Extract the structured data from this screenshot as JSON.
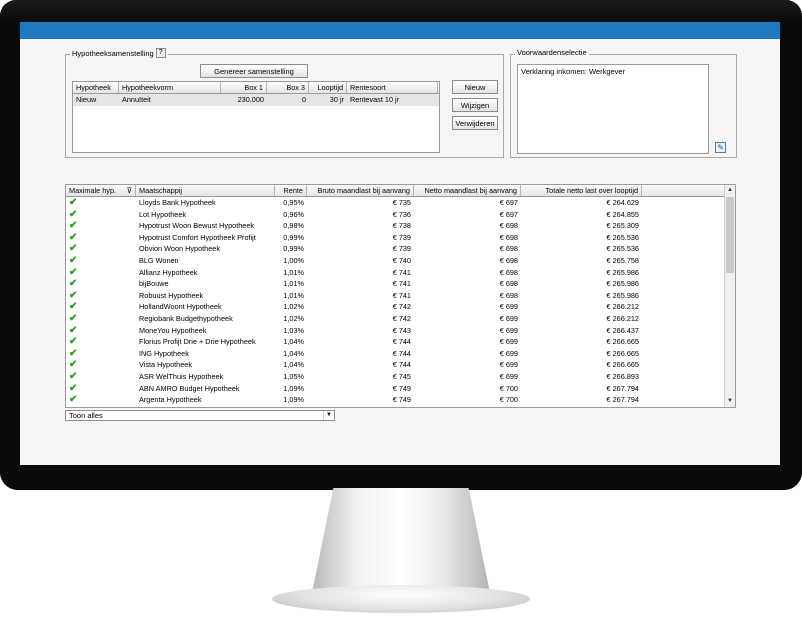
{
  "colors": {
    "titlebar": "#1d7ac3",
    "check": "#2c9f24"
  },
  "hypotheek": {
    "legend": "Hypotheeksamenstelling",
    "help_label": "?",
    "generate_button": "Genereer samenstelling",
    "columns": [
      "Hypotheek",
      "Hypotheekvorm",
      "Box 1",
      "Box 3",
      "Looptijd",
      "Rentesoort"
    ],
    "rows": [
      {
        "hypotheek": "Nieuw",
        "vorm": "Annuïteit",
        "box1": "230.000",
        "box3": "0",
        "looptijd": "30 jr",
        "rentesoort": "Rentevast 10 jr"
      }
    ],
    "buttons": {
      "nieuw": "Nieuw",
      "wijzigen": "Wijzigen",
      "verwijderen": "Verwijderen"
    }
  },
  "voorwaarden": {
    "legend": "Voorwaardenselectie",
    "text": "Verklaring inkomen: Werkgever",
    "edit_icon": "edit-icon"
  },
  "results": {
    "columns": [
      "Maximale hyp.",
      "Maatschappij",
      "Rente",
      "Bruto maandlast bij aanvang",
      "Netto maandlast bij aanvang",
      "Totale netto last over looptijd"
    ],
    "filter_icon": "filter-icon",
    "rows": [
      {
        "name": "Lloyds Bank Hypotheek",
        "rente": "0,95%",
        "bruto": "€ 735",
        "netto": "€ 697",
        "totaal": "€ 264.629"
      },
      {
        "name": "Lot Hypotheek",
        "rente": "0,96%",
        "bruto": "€ 736",
        "netto": "€ 697",
        "totaal": "€ 264.855"
      },
      {
        "name": "Hypotrust Woon Bewust Hypotheek",
        "rente": "0,98%",
        "bruto": "€ 738",
        "netto": "€ 698",
        "totaal": "€ 265.309"
      },
      {
        "name": "Hypotrust Comfort Hypotheek Profijt",
        "rente": "0,99%",
        "bruto": "€ 739",
        "netto": "€ 698",
        "totaal": "€ 265.536"
      },
      {
        "name": "Obvion Woon Hypotheek",
        "rente": "0,99%",
        "bruto": "€ 739",
        "netto": "€ 698",
        "totaal": "€ 265.536"
      },
      {
        "name": "BLG Wonen",
        "rente": "1,00%",
        "bruto": "€ 740",
        "netto": "€ 698",
        "totaal": "€ 265.758"
      },
      {
        "name": "Allianz Hypotheek",
        "rente": "1,01%",
        "bruto": "€ 741",
        "netto": "€ 698",
        "totaal": "€ 265.986"
      },
      {
        "name": "bijBouwe",
        "rente": "1,01%",
        "bruto": "€ 741",
        "netto": "€ 698",
        "totaal": "€ 265.986"
      },
      {
        "name": "Robuust Hypotheek",
        "rente": "1,01%",
        "bruto": "€ 741",
        "netto": "€ 698",
        "totaal": "€ 265.986"
      },
      {
        "name": "HollandWoont Hypotheek",
        "rente": "1,02%",
        "bruto": "€ 742",
        "netto": "€ 699",
        "totaal": "€ 266.212"
      },
      {
        "name": "Regiobank Budgethypotheek",
        "rente": "1,02%",
        "bruto": "€ 742",
        "netto": "€ 699",
        "totaal": "€ 266.212"
      },
      {
        "name": "MoneYou Hypotheek",
        "rente": "1,03%",
        "bruto": "€ 743",
        "netto": "€ 699",
        "totaal": "€ 266.437"
      },
      {
        "name": "Florius Profijt Drie + Drie Hypotheek",
        "rente": "1,04%",
        "bruto": "€ 744",
        "netto": "€ 699",
        "totaal": "€ 266.665"
      },
      {
        "name": "ING Hypotheek",
        "rente": "1,04%",
        "bruto": "€ 744",
        "netto": "€ 699",
        "totaal": "€ 266.665"
      },
      {
        "name": "Vista Hypotheek",
        "rente": "1,04%",
        "bruto": "€ 744",
        "netto": "€ 699",
        "totaal": "€ 266.665"
      },
      {
        "name": "ASR WelThuis Hypotheek",
        "rente": "1,05%",
        "bruto": "€ 745",
        "netto": "€ 699",
        "totaal": "€ 266.893"
      },
      {
        "name": "ABN AMRO Budget Hypotheek",
        "rente": "1,09%",
        "bruto": "€ 749",
        "netto": "€ 700",
        "totaal": "€ 267.794"
      },
      {
        "name": "Argenta Hypotheek",
        "rente": "1,09%",
        "bruto": "€ 749",
        "netto": "€ 700",
        "totaal": "€ 267.794"
      }
    ],
    "check_icon": "check-icon"
  },
  "filter_select": {
    "value": "Toon alles"
  }
}
